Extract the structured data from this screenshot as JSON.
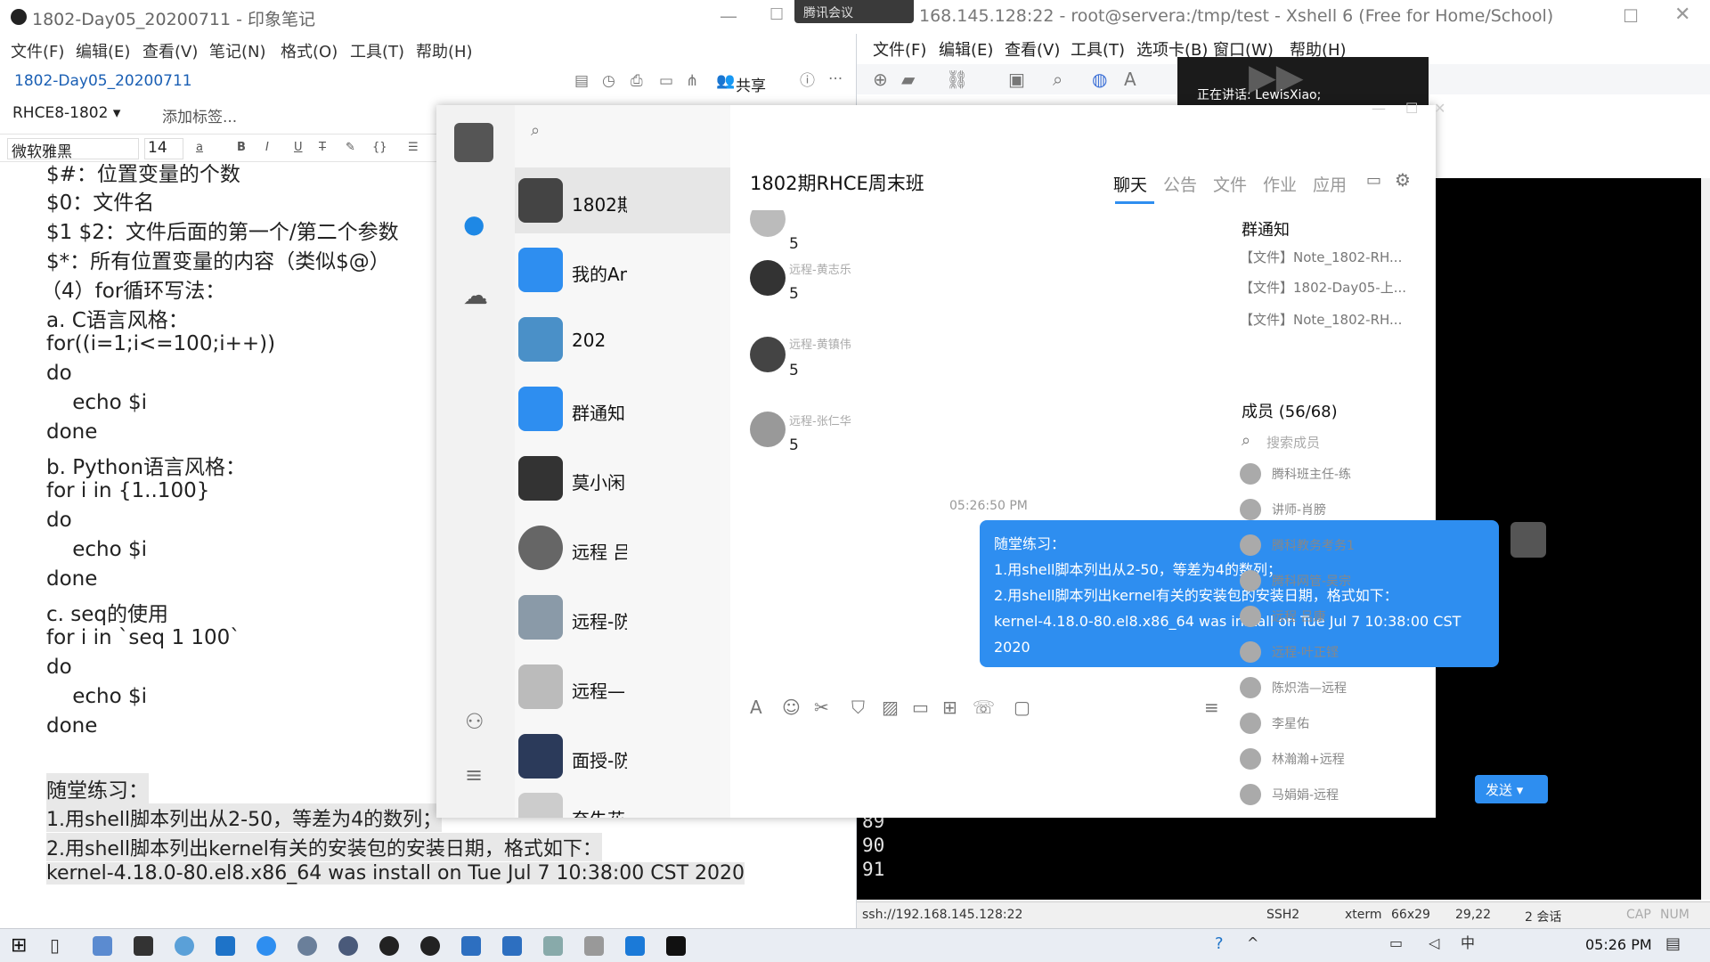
{
  "evernote": {
    "title": "1802-Day05_20200711 - 印象笔记",
    "menu": [
      "文件(F)",
      "编辑(E)",
      "查看(V)",
      "笔记(N)",
      "格式(O)",
      "工具(T)",
      "帮助(H)"
    ],
    "note_name": "1802-Day05_20200711",
    "share_label": "共享",
    "notebook": "RHCE8-1802",
    "add_tag": "添加标签...",
    "font": "微软雅黑",
    "font_size": "14",
    "lines": [
      "$#：位置变量的个数",
      "$0：文件名",
      "$1 $2：文件后面的第一个/第二个参数",
      "$*：所有位置变量的内容（类似$@）",
      "（4）for循环写法：",
      "a. C语言风格：",
      "for((i=1;i<=100;i++))",
      "do",
      "    echo $i",
      "done",
      "b. Python语言风格：",
      "for i in {1..100}",
      "do",
      "    echo $i",
      "done",
      "c. seq的使用",
      "for i in `seq 1 100`",
      "do",
      "    echo $i",
      "done",
      "",
      "随堂练习：",
      "1.用shell脚本列出从2-50，等差为4的数列；",
      "2.用shell脚本列出kernel有关的安装包的安装日期，格式如下：",
      "kernel-4.18.0-80.el8.x86_64 was install on Tue Jul 7 10:38:00 CST 2020"
    ]
  },
  "meeting": {
    "badge": "腾讯会议",
    "speaking": "正在讲话: LewisXiao;"
  },
  "xshell": {
    "title": "168.145.128:22 - root@servera:/tmp/test - Xshell 6 (Free for Home/School)",
    "menu": [
      "文件(F)",
      "编辑(E)",
      "查看(V)",
      "工具(T)",
      "选项卡(B)",
      "窗口(W)",
      "帮助(H)"
    ],
    "terminal_lines": [
      "89",
      "90",
      "91"
    ],
    "status": {
      "host": "ssh://192.168.145.128:22",
      "proto": "SSH2",
      "term": "xterm",
      "size": "66x29",
      "cursor": "29,22",
      "sessions": "2 会话",
      "cap": "CAP",
      "num": "NUM"
    }
  },
  "qq": {
    "contacts": [
      "1802期",
      "我的An",
      "202",
      "群通知",
      "莫小闲",
      "远程 吕",
      "远程-防",
      "远程—",
      "面授-防",
      "奈失花"
    ],
    "group_title": "1802期RHCE周末班",
    "tabs": [
      "聊天",
      "公告",
      "文件",
      "作业",
      "应用"
    ],
    "messages": [
      {
        "name": "",
        "text": "5"
      },
      {
        "name": "远程-黄志乐",
        "text": "5"
      },
      {
        "name": "远程-黄镇伟",
        "text": "5"
      },
      {
        "name": "远程-张仁华",
        "text": "5"
      }
    ],
    "timestamp": "05:26:50 PM",
    "bubble_lines": [
      "随堂练习：",
      "1.用shell脚本列出从2-50，等差为4的数列；",
      "2.用shell脚本列出kernel有关的安装包的安装日期，格式如下：",
      "kernel-4.18.0-80.el8.x86_64 was install on Tue Jul 7 10:38:00 CST",
      "2020"
    ],
    "send_label": "发送",
    "side": {
      "notice_title": "群通知",
      "files": [
        "【文件】Note_1802-RH...",
        "【文件】1802-Day05-上...",
        "【文件】Note_1802-RH..."
      ],
      "members_title": "成员 (56/68)",
      "search_members": "搜索成员",
      "members": [
        "腾科班主任-练",
        "讲师-肖膀",
        "腾科教务考务1",
        "腾科网管-吴宗",
        "远程 吕康",
        "远程-叶正铿",
        "陈炽浩—远程",
        "李星佑",
        "林瀚瀚+远程",
        "马娟娟-远程"
      ]
    }
  },
  "taskbar": {
    "clock": "05:26 PM"
  },
  "colors": {
    "accent": "#2e8ef0",
    "terminal_bg": "#000000"
  }
}
